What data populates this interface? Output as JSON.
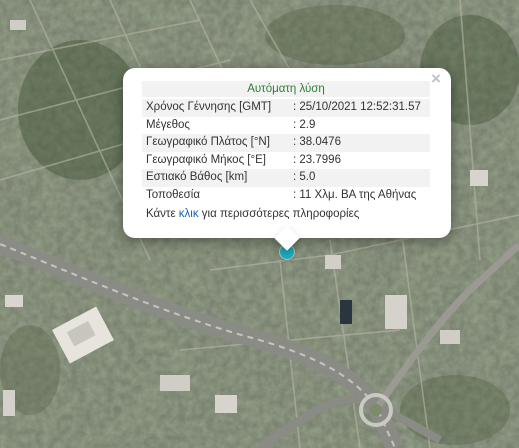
{
  "popup": {
    "title": "Αυτόματη λύση",
    "close_symbol": "×",
    "rows": [
      {
        "label": "Χρόνος Γέννησης [GMT]",
        "value": ": 25/10/2021 12:52:31.57"
      },
      {
        "label": "Μέγεθος",
        "value": ": 2.9"
      },
      {
        "label": "Γεωγραφικό Πλάτος [°N]",
        "value": ": 38.0476"
      },
      {
        "label": "Γεωγραφικό Μήκος [°E]",
        "value": ": 23.7996"
      },
      {
        "label": "Εστιακό Βάθος [km]",
        "value": ": 5.0"
      },
      {
        "label": "Τοποθεσία",
        "value": ": 11 Χλμ. ΒΑ της Αθήνας"
      }
    ],
    "more_prefix": "Κάντε ",
    "more_link": "κλικ",
    "more_suffix": " για περισσότερες πληροφορίες"
  },
  "colors": {
    "title": "#2e7d32",
    "link": "#1565c0",
    "marker": "#1ab0c4",
    "row_stripe": "#f2f2f2"
  },
  "icons": {
    "close": "close-icon",
    "marker": "epicenter-marker-icon"
  }
}
